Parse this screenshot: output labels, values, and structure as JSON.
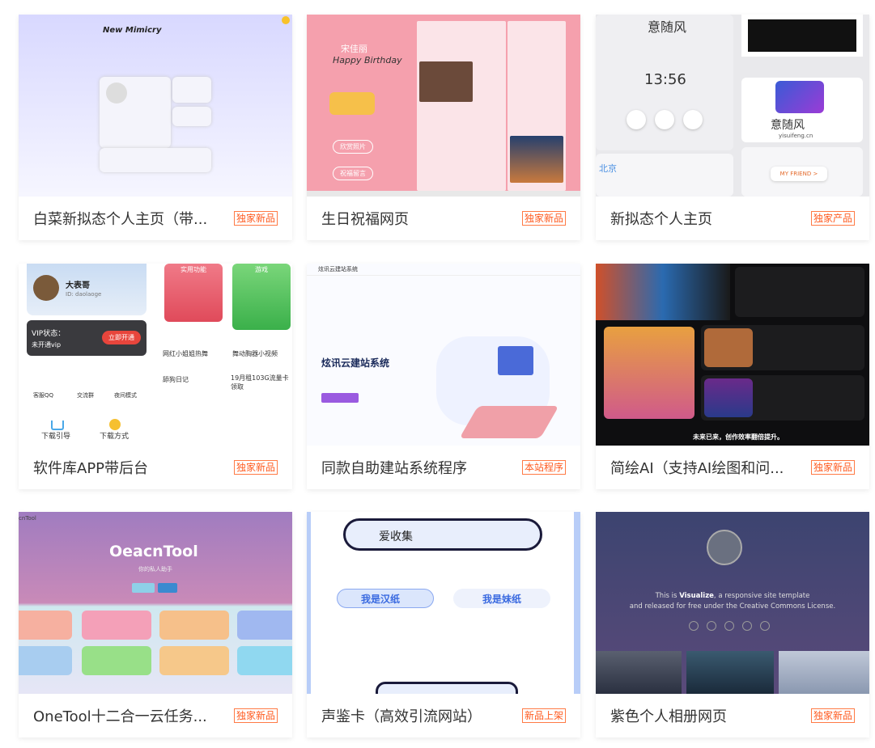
{
  "cards": [
    {
      "title": "白菜新拟态个人主页（带...",
      "badge": "独家新品",
      "thumb": {
        "heading": "New Mimicry"
      }
    },
    {
      "title": "生日祝福网页",
      "badge": "独家新品",
      "thumb": {
        "heading": "宋佳丽",
        "sub": "Happy Birthday",
        "btn1": "欣赏照片",
        "btn2": "祝福留言"
      }
    },
    {
      "title": "新拟态个人主页",
      "badge": "独家产品",
      "thumb": {
        "name": "意随风",
        "time": "13:56",
        "logo": "意随风",
        "domain": "yisuifeng.cn",
        "friend": "MY FRIEND >",
        "city": "北京"
      }
    },
    {
      "title": "软件库APP带后台",
      "badge": "独家新品",
      "thumb": {
        "user": "大表哥",
        "uid": "ID: daolaoge",
        "vip": "VIP状态：",
        "vip_sub": "未开通vip",
        "vip_btn": "立即开通",
        "tab1": "实用功能",
        "tab2": "游戏",
        "item1": "网红小姐姐热舞",
        "item2": "舞动胸器小视频",
        "item3": "舔狗日记",
        "item4": "19月租103G流量卡领取",
        "icons": [
          "客服QQ",
          "交流群",
          "夜间模式",
          "下载引导",
          "下载方式"
        ]
      }
    },
    {
      "title": "同款自助建站系统程序",
      "badge": "本站程序",
      "thumb": {
        "brand": "炫讯云建站系统",
        "hero": "炫讯云建站系统"
      }
    },
    {
      "title": "简绘AI（支持AI绘图和问...",
      "badge": "独家新品",
      "thumb": {
        "slogan": "未来已来，创作效率翻倍提升。"
      }
    },
    {
      "title": "OneTool十二合一云任务...",
      "badge": "独家新品",
      "thumb": {
        "heading": "OeacnTool",
        "sub": "你的私人助手",
        "corner": "cnTool"
      }
    },
    {
      "title": "声鉴卡（高效引流网站）",
      "badge": "新品上架",
      "thumb": {
        "search": "爱收集",
        "male": "我是汉纸",
        "female": "我是妹纸"
      }
    },
    {
      "title": "紫色个人相册网页",
      "badge": "独家新品",
      "thumb": {
        "line1a": "This is ",
        "line1b": "Visualize",
        "line1c": ", a responsive site template",
        "line2": "and released for free under the Creative Commons License."
      }
    }
  ],
  "colors": {
    "badge": "#ff5a1f",
    "title": "#333333"
  }
}
